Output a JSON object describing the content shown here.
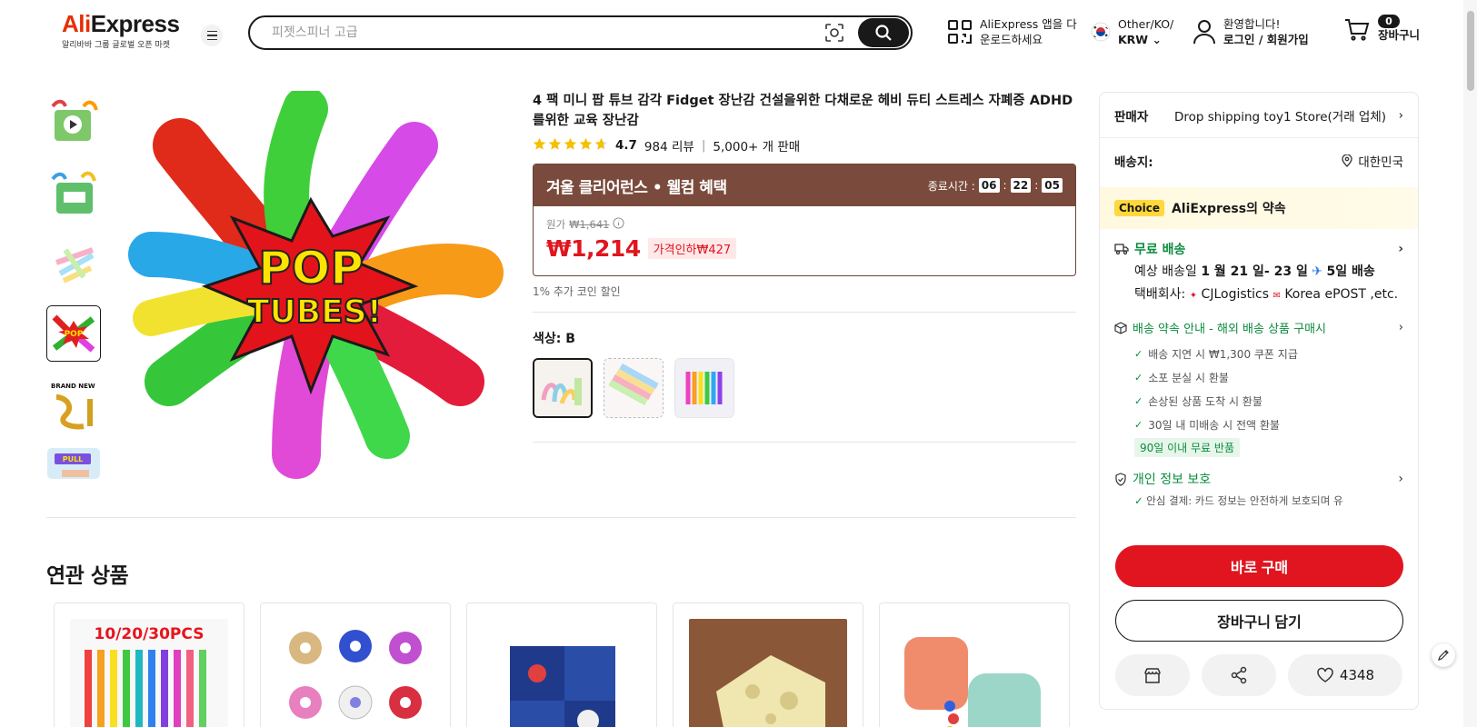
{
  "header": {
    "logo_text_pre": "Ali",
    "logo_text_post": "Express",
    "logo_sub": "알리바바 그룹 글로벌 오픈 마켓",
    "search_placeholder": "피젯스피너 고급",
    "app_line1": "AliExpress 앱을 다",
    "app_line2": "운로드하세요",
    "lang_line1": "Other/KO/",
    "lang_line2": "KRW",
    "welcome": "환영합니다!",
    "login": "로그인 / 회원가입",
    "cart_count": "0",
    "cart_label": "장바구니"
  },
  "product": {
    "title": "4 팩 미니 팝 튜브 감각 Fidget 장난감 건설을위한 다채로운 헤비 듀티 스트레스 자폐증 ADHD를위한 교육 장난감",
    "rating": "4.7",
    "reviews": "984 리뷰",
    "sold": "5,000+ 개 판매",
    "promo_title": "겨울 클리어런스 • 웰컴 혜택",
    "timer_label": "종료시간 :",
    "timer": [
      "06",
      "22",
      "05"
    ],
    "orig_label": "원가",
    "orig_price": "₩1,641",
    "price": "₩1,214",
    "discount": "가격인하₩427",
    "coin": "1% 추가 코인 할인",
    "color_label": "색상: B"
  },
  "related": {
    "title": "연관 상품",
    "card1_text": "10/20/30PCS"
  },
  "panel": {
    "seller_label": "판매자",
    "seller_value": "Drop shipping toy1 Store(거래 업체)",
    "ship_label": "배송지:",
    "ship_value": "대한민국",
    "choice_tag": "Choice",
    "choice_text": "AliExpress의 약속",
    "free_ship": "무료 배송",
    "est_pre": "예상 배송일",
    "est_dates": "1 월 21 일- 23 일",
    "est_days": "5일 배송",
    "carrier_pre": "택배회사:",
    "carrier_1": "CJLogistics",
    "carrier_2": "Korea ePOST ,etc.",
    "promise_head": "배송 약속 안내 - 해외 배송 상품 구매시",
    "checks": [
      "배송 지연 시 ₩1,300 쿠폰 지급",
      "소포 분실 시 환불",
      "손상된 상품 도착 시 환불",
      "30일 내 미배송 시 전액 환불"
    ],
    "return_tag": "90일 이내 무료 반품",
    "privacy_head": "개인 정보 보호",
    "privacy_sub": "안심 결제: 카드 정보는 안전하게 보호되며 유",
    "buy_now": "바로 구매",
    "add_cart": "장바구니 담기",
    "wish_count": "4348"
  },
  "colors": {
    "brand_red": "#e0151f",
    "promo_brown": "#7a4b3d",
    "choice_yellow": "#ffd83d",
    "green": "#0b8c3e"
  }
}
